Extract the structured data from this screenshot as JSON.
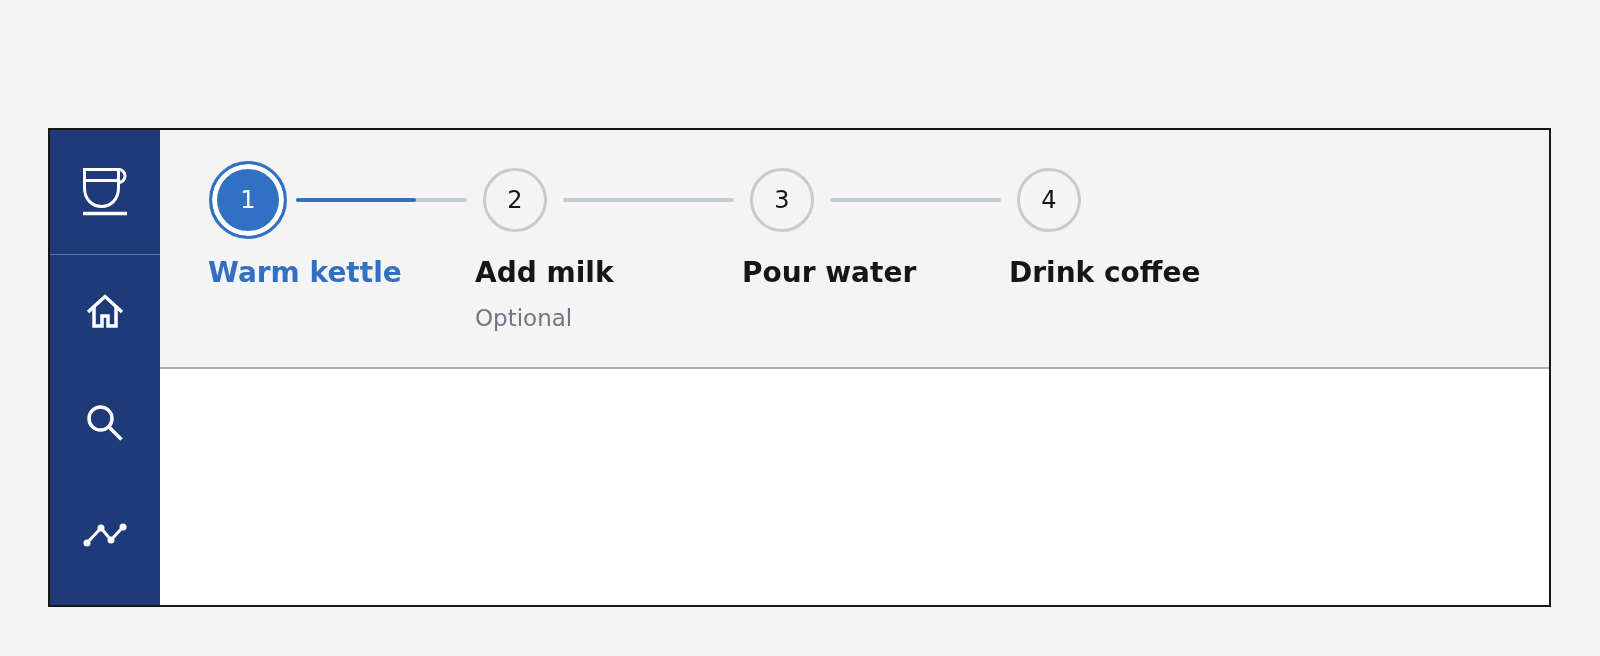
{
  "stepper": {
    "steps": [
      {
        "number": "1",
        "label": "Warm kettle",
        "selected": true,
        "connector": {
          "level": 0.7
        }
      },
      {
        "number": "2",
        "label": "Add milk",
        "note": "Optional",
        "selected": false
      },
      {
        "number": "3",
        "label": "Pour water",
        "selected": false
      },
      {
        "number": "4",
        "label": "Drink coffee",
        "selected": false
      }
    ]
  }
}
